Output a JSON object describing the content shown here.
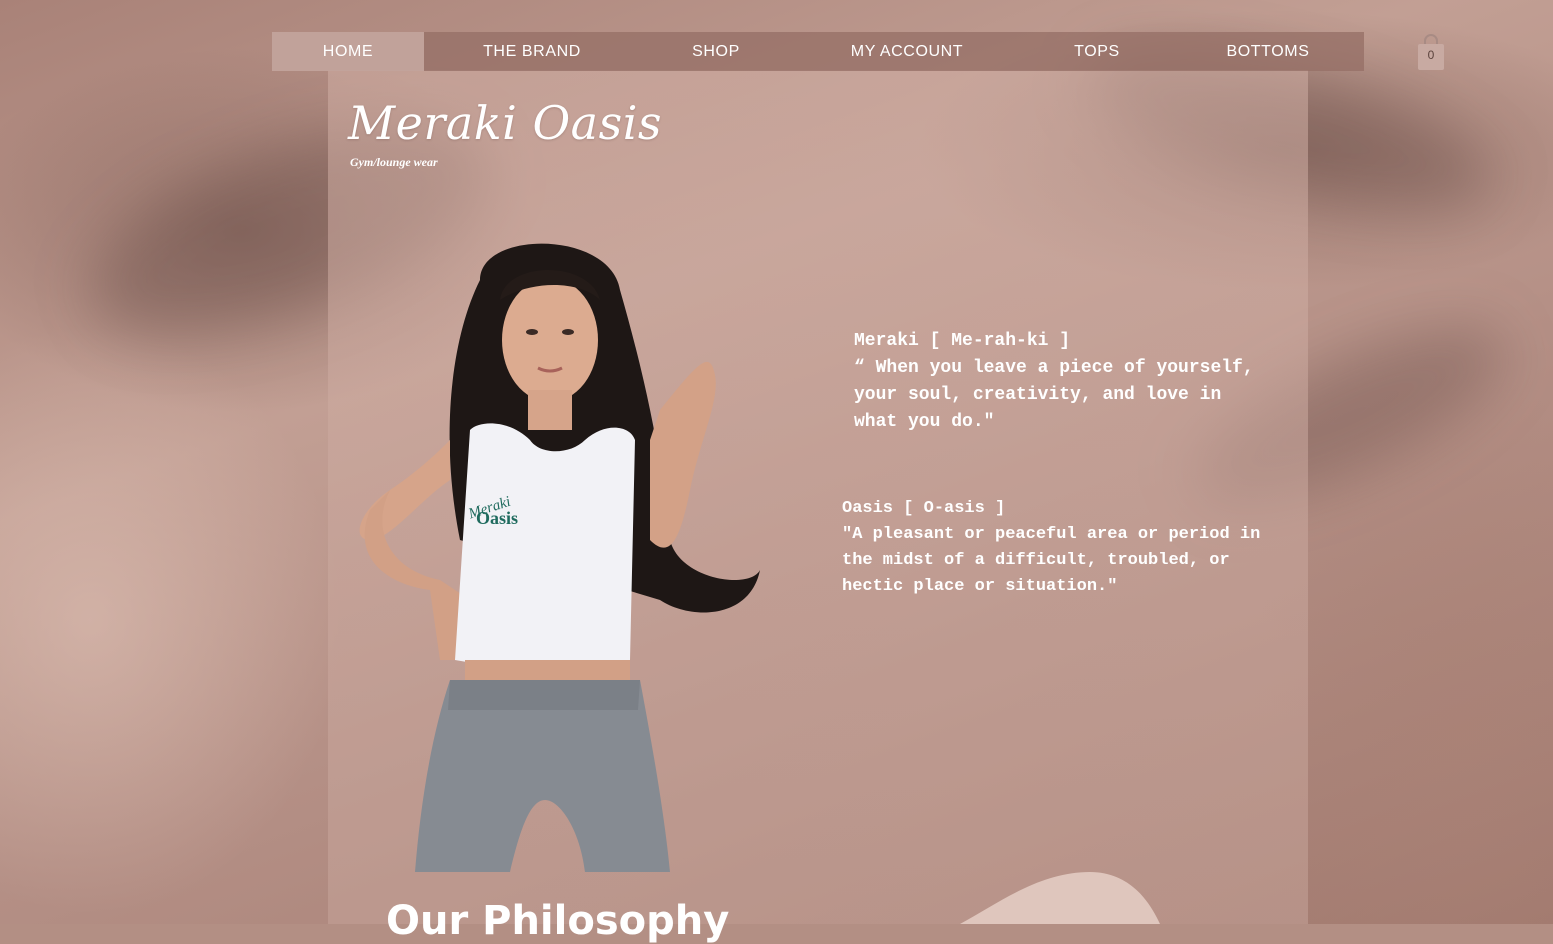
{
  "nav": {
    "items": [
      {
        "label": "HOME",
        "active": true
      },
      {
        "label": "THE BRAND",
        "active": false
      },
      {
        "label": "SHOP",
        "active": false
      },
      {
        "label": "MY ACCOUNT",
        "active": false
      },
      {
        "label": "TOPS",
        "active": false
      },
      {
        "label": "BOTTOMS",
        "active": false
      }
    ]
  },
  "cart": {
    "icon": "shopping-bag-icon",
    "count": "0"
  },
  "brand": {
    "name": "Meraki Oasis",
    "tagline": "Gym/lounge wear"
  },
  "hero": {
    "shirt_logo_top": "Meraki",
    "shirt_logo_bottom": "Oasis"
  },
  "definitions": {
    "meraki": {
      "term": "Meraki [ Me-rah-ki ]",
      "text": "“ When you leave a piece of yourself,\nyour soul, creativity, and love in\nwhat you do.\""
    },
    "oasis": {
      "term": "Oasis [ O-asis ]",
      "text": "\"A pleasant or peaceful area or period in\nthe midst of a difficult, troubled, or\nhectic place or situation.\""
    }
  },
  "philosophy": {
    "heading": "Our Philosophy"
  },
  "colors": {
    "nav_bg": "#96706a",
    "nav_active_bg": "#cdb2aa",
    "text": "#ffffff",
    "shirt_logo": "#1f6b5e"
  }
}
